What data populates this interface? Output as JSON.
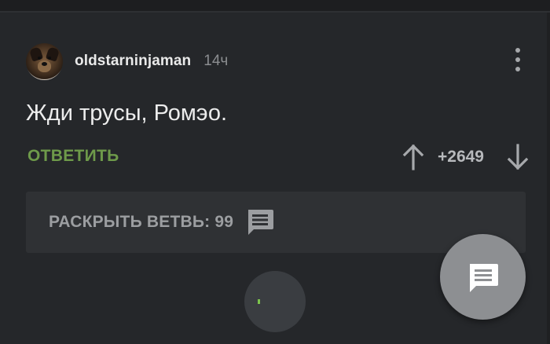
{
  "comment": {
    "author": "oldstarninjaman",
    "time": "14ч",
    "text": "Жди трусы, Ромэо.",
    "reply_label": "ОТВЕТИТЬ",
    "rating": "+2649"
  },
  "branch": {
    "label": "РАСКРЫТЬ ВЕТВЬ: 99"
  },
  "icons": {
    "more": "more-vertical-icon",
    "upvote": "arrow-up-icon",
    "downvote": "arrow-down-icon",
    "expand": "comment-icon",
    "fab": "comment-icon",
    "loader": "loading-spinner"
  },
  "colors": {
    "background": "#25272a",
    "accent_green": "#6e9a4a",
    "panel": "#2f3134",
    "fab": "#8d8f92"
  }
}
